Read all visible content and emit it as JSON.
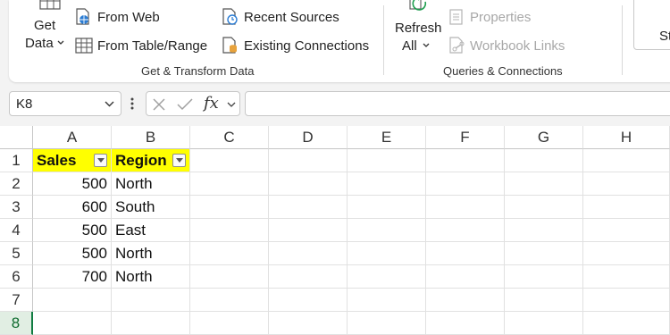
{
  "ribbon": {
    "get_data": {
      "line1": "Get",
      "line2": "Data"
    },
    "from_web": "From Web",
    "from_table": "From Table/Range",
    "recent_sources": "Recent Sources",
    "existing_connections": "Existing Connections",
    "group_get_transform": "Get & Transform Data",
    "refresh_all": {
      "line1": "Refresh",
      "line2": "All"
    },
    "properties": "Properties",
    "workbook_links": "Workbook Links",
    "group_queries": "Queries & Connections",
    "partial_label": "St"
  },
  "formula_bar": {
    "name_box": "K8",
    "fx": "fx",
    "content": ""
  },
  "sheet": {
    "columns": [
      "A",
      "B",
      "C",
      "D",
      "E",
      "F",
      "G",
      "H"
    ],
    "rows": [
      "1",
      "2",
      "3",
      "4",
      "5",
      "6",
      "7",
      "8"
    ],
    "selected_row": "8",
    "headers": [
      "Sales",
      "Region"
    ],
    "data": [
      {
        "sales": "500",
        "region": "North"
      },
      {
        "sales": "600",
        "region": "South"
      },
      {
        "sales": "500",
        "region": "East"
      },
      {
        "sales": "500",
        "region": "North"
      },
      {
        "sales": "700",
        "region": "North"
      }
    ]
  },
  "colors": {
    "header_fill": "#ffff00",
    "selected_row_accent": "#107c41",
    "ribbon_bg": "#ffffff",
    "app_bg": "#f3f3f3"
  }
}
